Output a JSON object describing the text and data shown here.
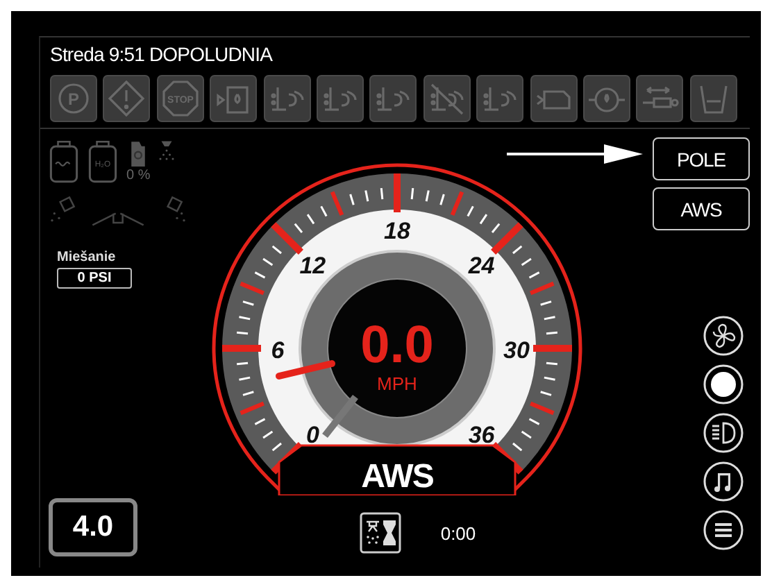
{
  "header": {
    "datetime": "Streda 9:51 DOPOLUDNIA"
  },
  "indicators": [
    {
      "kind": "parking",
      "label": "P"
    },
    {
      "kind": "warning"
    },
    {
      "kind": "stop",
      "label": "STOP"
    },
    {
      "kind": "tank-drop"
    },
    {
      "kind": "level-spray"
    },
    {
      "kind": "alert-spray"
    },
    {
      "kind": "boom-spray"
    },
    {
      "kind": "no-spray"
    },
    {
      "kind": "temp-spray"
    },
    {
      "kind": "engine"
    },
    {
      "kind": "oil"
    },
    {
      "kind": "cylinder"
    },
    {
      "kind": "bucket"
    }
  ],
  "tanks": [
    {
      "kind": "rinse"
    },
    {
      "kind": "water",
      "label": "H₂O"
    }
  ],
  "agitation": {
    "reading": "0 %"
  },
  "mixing": {
    "label": "Miešanie",
    "value": "0 PSI"
  },
  "gear": {
    "value": "4.0"
  },
  "gauge": {
    "tick_labels": [
      "0",
      "6",
      "12",
      "18",
      "24",
      "30",
      "36"
    ],
    "reading": "0.0",
    "unit": "MPH",
    "mode": "AWS"
  },
  "mode_buttons": [
    {
      "label": "POLE"
    },
    {
      "label": "AWS"
    }
  ],
  "round_buttons": [
    {
      "kind": "fan"
    },
    {
      "kind": "sun"
    },
    {
      "kind": "headlight"
    },
    {
      "kind": "music"
    },
    {
      "kind": "menu"
    }
  ],
  "timer": {
    "value": "0:00"
  }
}
